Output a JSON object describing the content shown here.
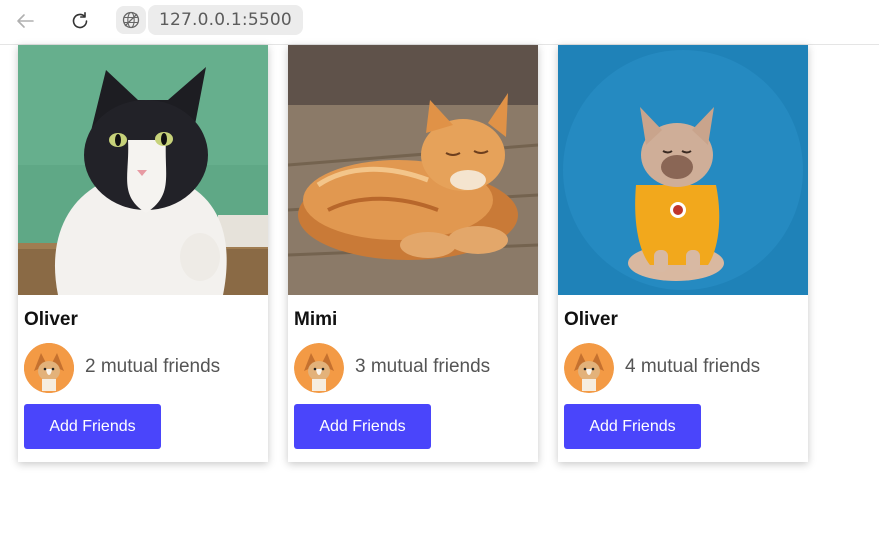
{
  "browser": {
    "url": "127.0.0.1:5500",
    "icons": {
      "back": "back-arrow-icon",
      "reload": "reload-icon",
      "site_info": "globe-icon"
    }
  },
  "cards": [
    {
      "name": "Oliver",
      "mutual": "2 mutual friends",
      "button": "Add Friends",
      "photo": "tuxedo cat on wooden ledge, green background"
    },
    {
      "name": "Mimi",
      "mutual": "3 mutual friends",
      "button": "Add Friends",
      "photo": "orange tabby cat lying on wooden floor"
    },
    {
      "name": "Oliver",
      "mutual": "4 mutual friends",
      "button": "Add Friends",
      "photo": "french bulldog in yellow shirt, blue background"
    }
  ],
  "colors": {
    "button": "#4a45fb",
    "button_text": "#ffffff",
    "muted_text": "#555555"
  }
}
